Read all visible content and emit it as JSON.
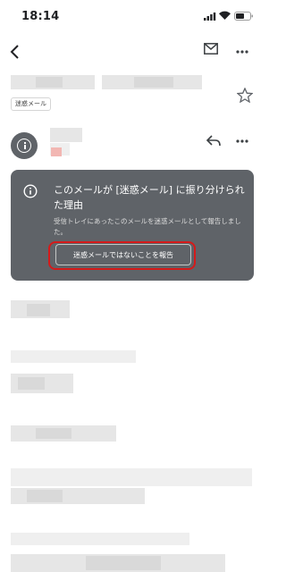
{
  "status": {
    "time": "18:14"
  },
  "message": {
    "spam_label": "迷惑メール"
  },
  "spam_card": {
    "title": "このメールが [迷惑メール] に振り分けられた理由",
    "description": "受信トレイにあったこのメールを迷惑メールとして報告しました。",
    "report_button": "迷惑メールではないことを報告"
  },
  "colors": {
    "card_bg": "#5f6368",
    "highlight": "#d51a1a",
    "avatar": "#5f6368"
  },
  "icons": [
    "back-icon",
    "mail-icon",
    "more-icon",
    "star-icon",
    "info-icon",
    "reply-icon"
  ]
}
